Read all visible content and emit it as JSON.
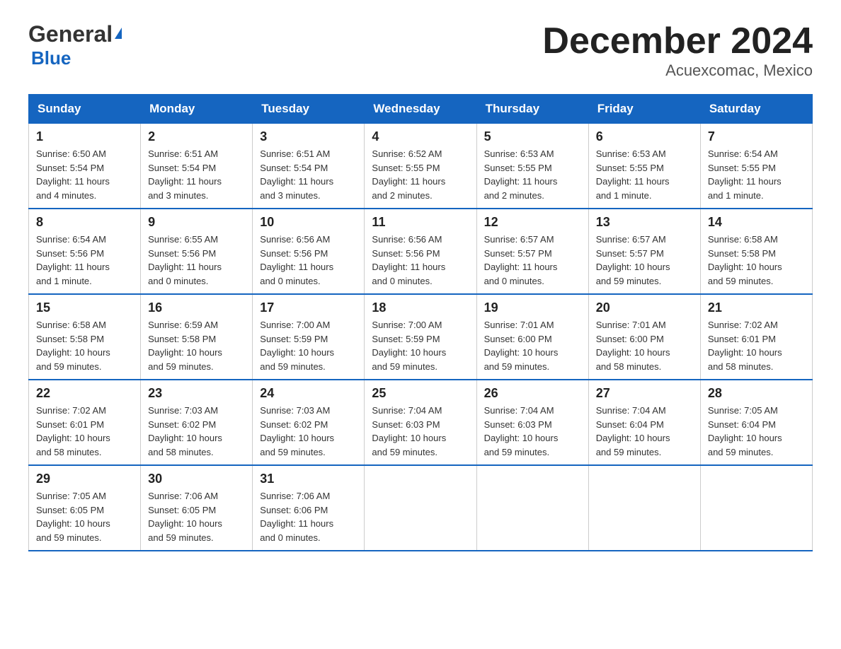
{
  "logo": {
    "general": "General",
    "blue_text": "Blue",
    "tagline": ""
  },
  "title": "December 2024",
  "subtitle": "Acuexcomac, Mexico",
  "days_header": [
    "Sunday",
    "Monday",
    "Tuesday",
    "Wednesday",
    "Thursday",
    "Friday",
    "Saturday"
  ],
  "weeks": [
    [
      {
        "day": "1",
        "info": "Sunrise: 6:50 AM\nSunset: 5:54 PM\nDaylight: 11 hours\nand 4 minutes."
      },
      {
        "day": "2",
        "info": "Sunrise: 6:51 AM\nSunset: 5:54 PM\nDaylight: 11 hours\nand 3 minutes."
      },
      {
        "day": "3",
        "info": "Sunrise: 6:51 AM\nSunset: 5:54 PM\nDaylight: 11 hours\nand 3 minutes."
      },
      {
        "day": "4",
        "info": "Sunrise: 6:52 AM\nSunset: 5:55 PM\nDaylight: 11 hours\nand 2 minutes."
      },
      {
        "day": "5",
        "info": "Sunrise: 6:53 AM\nSunset: 5:55 PM\nDaylight: 11 hours\nand 2 minutes."
      },
      {
        "day": "6",
        "info": "Sunrise: 6:53 AM\nSunset: 5:55 PM\nDaylight: 11 hours\nand 1 minute."
      },
      {
        "day": "7",
        "info": "Sunrise: 6:54 AM\nSunset: 5:55 PM\nDaylight: 11 hours\nand 1 minute."
      }
    ],
    [
      {
        "day": "8",
        "info": "Sunrise: 6:54 AM\nSunset: 5:56 PM\nDaylight: 11 hours\nand 1 minute."
      },
      {
        "day": "9",
        "info": "Sunrise: 6:55 AM\nSunset: 5:56 PM\nDaylight: 11 hours\nand 0 minutes."
      },
      {
        "day": "10",
        "info": "Sunrise: 6:56 AM\nSunset: 5:56 PM\nDaylight: 11 hours\nand 0 minutes."
      },
      {
        "day": "11",
        "info": "Sunrise: 6:56 AM\nSunset: 5:56 PM\nDaylight: 11 hours\nand 0 minutes."
      },
      {
        "day": "12",
        "info": "Sunrise: 6:57 AM\nSunset: 5:57 PM\nDaylight: 11 hours\nand 0 minutes."
      },
      {
        "day": "13",
        "info": "Sunrise: 6:57 AM\nSunset: 5:57 PM\nDaylight: 10 hours\nand 59 minutes."
      },
      {
        "day": "14",
        "info": "Sunrise: 6:58 AM\nSunset: 5:58 PM\nDaylight: 10 hours\nand 59 minutes."
      }
    ],
    [
      {
        "day": "15",
        "info": "Sunrise: 6:58 AM\nSunset: 5:58 PM\nDaylight: 10 hours\nand 59 minutes."
      },
      {
        "day": "16",
        "info": "Sunrise: 6:59 AM\nSunset: 5:58 PM\nDaylight: 10 hours\nand 59 minutes."
      },
      {
        "day": "17",
        "info": "Sunrise: 7:00 AM\nSunset: 5:59 PM\nDaylight: 10 hours\nand 59 minutes."
      },
      {
        "day": "18",
        "info": "Sunrise: 7:00 AM\nSunset: 5:59 PM\nDaylight: 10 hours\nand 59 minutes."
      },
      {
        "day": "19",
        "info": "Sunrise: 7:01 AM\nSunset: 6:00 PM\nDaylight: 10 hours\nand 59 minutes."
      },
      {
        "day": "20",
        "info": "Sunrise: 7:01 AM\nSunset: 6:00 PM\nDaylight: 10 hours\nand 58 minutes."
      },
      {
        "day": "21",
        "info": "Sunrise: 7:02 AM\nSunset: 6:01 PM\nDaylight: 10 hours\nand 58 minutes."
      }
    ],
    [
      {
        "day": "22",
        "info": "Sunrise: 7:02 AM\nSunset: 6:01 PM\nDaylight: 10 hours\nand 58 minutes."
      },
      {
        "day": "23",
        "info": "Sunrise: 7:03 AM\nSunset: 6:02 PM\nDaylight: 10 hours\nand 58 minutes."
      },
      {
        "day": "24",
        "info": "Sunrise: 7:03 AM\nSunset: 6:02 PM\nDaylight: 10 hours\nand 59 minutes."
      },
      {
        "day": "25",
        "info": "Sunrise: 7:04 AM\nSunset: 6:03 PM\nDaylight: 10 hours\nand 59 minutes."
      },
      {
        "day": "26",
        "info": "Sunrise: 7:04 AM\nSunset: 6:03 PM\nDaylight: 10 hours\nand 59 minutes."
      },
      {
        "day": "27",
        "info": "Sunrise: 7:04 AM\nSunset: 6:04 PM\nDaylight: 10 hours\nand 59 minutes."
      },
      {
        "day": "28",
        "info": "Sunrise: 7:05 AM\nSunset: 6:04 PM\nDaylight: 10 hours\nand 59 minutes."
      }
    ],
    [
      {
        "day": "29",
        "info": "Sunrise: 7:05 AM\nSunset: 6:05 PM\nDaylight: 10 hours\nand 59 minutes."
      },
      {
        "day": "30",
        "info": "Sunrise: 7:06 AM\nSunset: 6:05 PM\nDaylight: 10 hours\nand 59 minutes."
      },
      {
        "day": "31",
        "info": "Sunrise: 7:06 AM\nSunset: 6:06 PM\nDaylight: 11 hours\nand 0 minutes."
      },
      {
        "day": "",
        "info": ""
      },
      {
        "day": "",
        "info": ""
      },
      {
        "day": "",
        "info": ""
      },
      {
        "day": "",
        "info": ""
      }
    ]
  ]
}
